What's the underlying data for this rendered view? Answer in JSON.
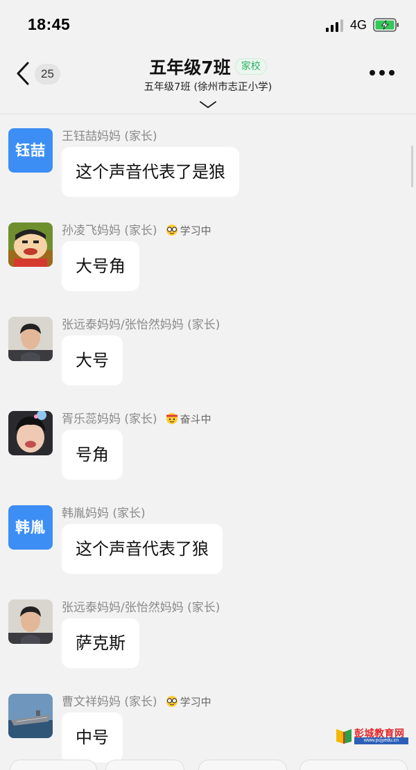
{
  "status_bar": {
    "time": "18:45",
    "network": "4G"
  },
  "header": {
    "back_count": "25",
    "title": "五年级7班",
    "badge": "家校",
    "subtitle": "五年级7班 (徐州市志正小学)"
  },
  "messages": [
    {
      "avatar_text": "钰喆",
      "sender": "王钰喆妈妈 (家长)",
      "status": "",
      "text": "这个声音代表了是狼"
    },
    {
      "avatar_text": "",
      "sender": "孙凌飞妈妈 (家长)",
      "status": "学习中",
      "text": "大号角"
    },
    {
      "avatar_text": "",
      "sender": "张远泰妈妈/张怡然妈妈 (家长)",
      "status": "",
      "text": "大号"
    },
    {
      "avatar_text": "",
      "sender": "胥乐蕊妈妈 (家长)",
      "status": "奋斗中",
      "text": "号角"
    },
    {
      "avatar_text": "韩胤",
      "sender": "韩胤妈妈 (家长)",
      "status": "",
      "text": "这个声音代表了狼"
    },
    {
      "avatar_text": "",
      "sender": "张远泰妈妈/张怡然妈妈 (家长)",
      "status": "",
      "text": "萨克斯"
    },
    {
      "avatar_text": "",
      "sender": "曹文祥妈妈 (家长)",
      "status": "学习中",
      "text": "中号"
    }
  ],
  "watermark": {
    "name": "彭城教育网",
    "url": "www.pcjyedu.cn"
  },
  "colors": {
    "accent_blue": "#3d8ef4",
    "badge_green": "#2fae63",
    "background": "#f2f2f2"
  }
}
